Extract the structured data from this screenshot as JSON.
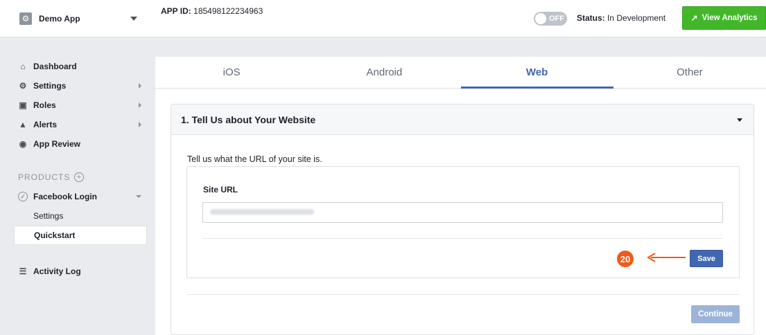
{
  "topbar": {
    "app_name": "Demo App",
    "app_id_label": "APP ID:",
    "app_id_value": "185498122234963",
    "toggle_label": "OFF",
    "status_label": "Status:",
    "status_value": "In Development",
    "analytics_label": "View Analytics",
    "analytics_color": "#42b72a"
  },
  "sidebar": {
    "items": [
      {
        "label": "Dashboard",
        "icon": "home-icon"
      },
      {
        "label": "Settings",
        "icon": "gear-icon"
      },
      {
        "label": "Roles",
        "icon": "roles-icon"
      },
      {
        "label": "Alerts",
        "icon": "bell-icon"
      },
      {
        "label": "App Review",
        "icon": "eye-icon"
      }
    ],
    "products_label": "PRODUCTS",
    "product": {
      "label": "Facebook Login",
      "subitems": [
        "Settings",
        "Quickstart"
      ],
      "active_subitem": "Quickstart"
    },
    "activity_label": "Activity Log"
  },
  "tabs": {
    "items": [
      "iOS",
      "Android",
      "Web",
      "Other"
    ],
    "active": "Web",
    "accent_color": "#4267b2"
  },
  "section": {
    "title": "1. Tell Us about Your Website",
    "intro": "Tell us what the URL of your site is.",
    "site_url_label": "Site URL",
    "step_badge": "20",
    "save_label": "Save",
    "continue_label": "Continue"
  }
}
